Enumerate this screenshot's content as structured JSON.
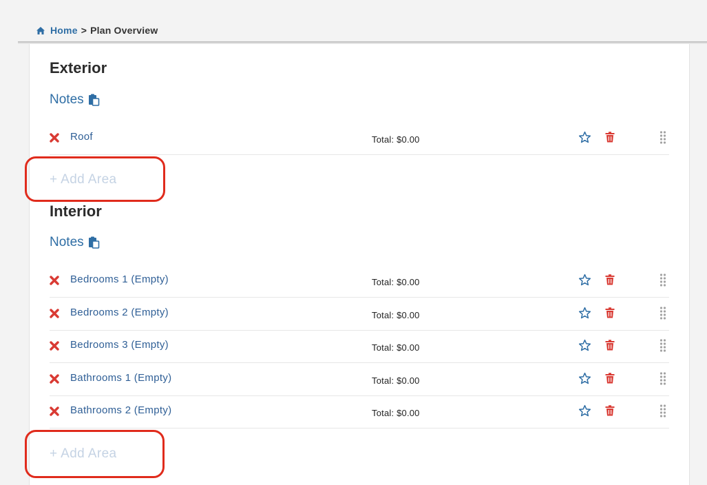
{
  "breadcrumb": {
    "home": "Home",
    "separator": ">",
    "current": "Plan Overview"
  },
  "sections": [
    {
      "title": "Exterior",
      "notes_label": "Notes",
      "add_area_label": "+ Add Area",
      "rows": [
        {
          "name": "Roof",
          "total": "Total: $0.00"
        }
      ]
    },
    {
      "title": "Interior",
      "notes_label": "Notes",
      "add_area_label": "+ Add Area",
      "rows": [
        {
          "name": "Bedrooms 1 (Empty)",
          "total": "Total: $0.00"
        },
        {
          "name": "Bedrooms 2 (Empty)",
          "total": "Total: $0.00"
        },
        {
          "name": "Bedrooms 3 (Empty)",
          "total": "Total: $0.00"
        },
        {
          "name": "Bathrooms 1 (Empty)",
          "total": "Total: $0.00"
        },
        {
          "name": "Bathrooms 2 (Empty)",
          "total": "Total: $0.00"
        }
      ]
    }
  ],
  "colors": {
    "link": "#2f6ea5",
    "remove": "#d93a33",
    "add_area": "#c5d3e4",
    "highlight": "#e02b1c"
  },
  "icons": {
    "home": "home-icon",
    "notes": "clipboard-icon",
    "remove": "close-icon",
    "favorite": "star-icon",
    "delete": "trash-icon",
    "reorder": "drag-handle-icon"
  }
}
